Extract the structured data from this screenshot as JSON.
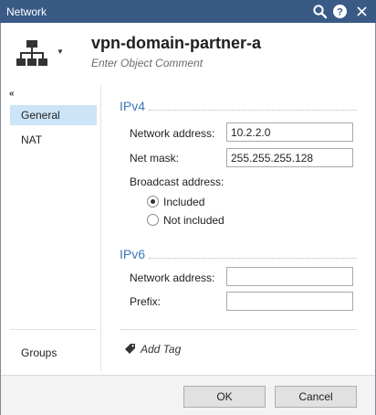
{
  "window": {
    "title": "Network",
    "icons": [
      "search-icon",
      "help-icon",
      "close-icon"
    ]
  },
  "header": {
    "object_icon": "network-icon",
    "object_name": "vpn-domain-partner-a",
    "comment_placeholder": "Enter Object Comment"
  },
  "sidebar": {
    "collapse_glyph": "«",
    "items": [
      {
        "label": "General",
        "active": true
      },
      {
        "label": "NAT",
        "active": false
      }
    ],
    "bottom_item": "Groups"
  },
  "ipv4": {
    "title": "IPv4",
    "network_address_label": "Network address:",
    "network_address_value": "10.2.2.0",
    "net_mask_label": "Net mask:",
    "net_mask_value": "255.255.255.128",
    "broadcast_label": "Broadcast address:",
    "broadcast_options": [
      {
        "label": "Included",
        "checked": true
      },
      {
        "label": "Not included",
        "checked": false
      }
    ]
  },
  "ipv6": {
    "title": "IPv6",
    "network_address_label": "Network address:",
    "network_address_value": "",
    "prefix_label": "Prefix:",
    "prefix_value": ""
  },
  "tags": {
    "add_tag_label": "Add Tag",
    "icon": "tag-icon"
  },
  "footer": {
    "ok_label": "OK",
    "cancel_label": "Cancel"
  },
  "colors": {
    "titlebar": "#3a5a86",
    "section_title": "#3d78b8",
    "active_nav": "#cce4f7"
  }
}
